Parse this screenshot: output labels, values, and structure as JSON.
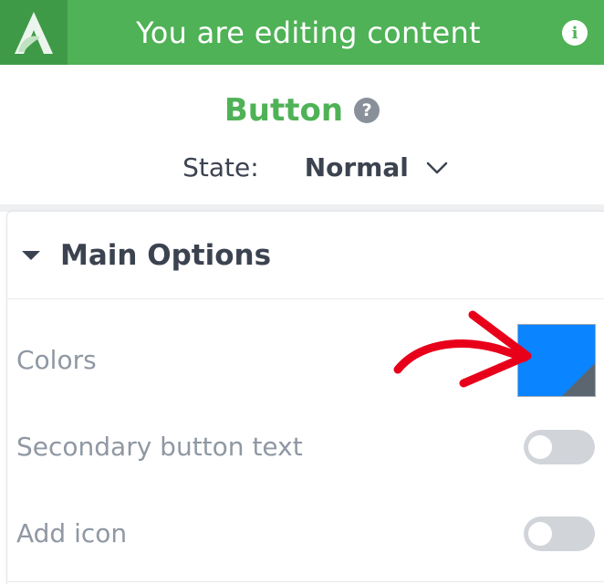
{
  "header": {
    "title": "You are editing content",
    "brand_color": "#4fb256",
    "info_icon": "info-icon"
  },
  "element": {
    "title": "Button",
    "help_icon": "question-icon",
    "state_label": "State:",
    "state_value": "Normal"
  },
  "section": {
    "title": "Main Options",
    "expanded": true
  },
  "options": {
    "colors_label": "Colors",
    "colors_value": "#0a84ff",
    "secondary_text_label": "Secondary button text",
    "secondary_text_enabled": false,
    "add_icon_label": "Add icon",
    "add_icon_enabled": false
  },
  "annotation": {
    "arrow_color": "#e8001a"
  }
}
